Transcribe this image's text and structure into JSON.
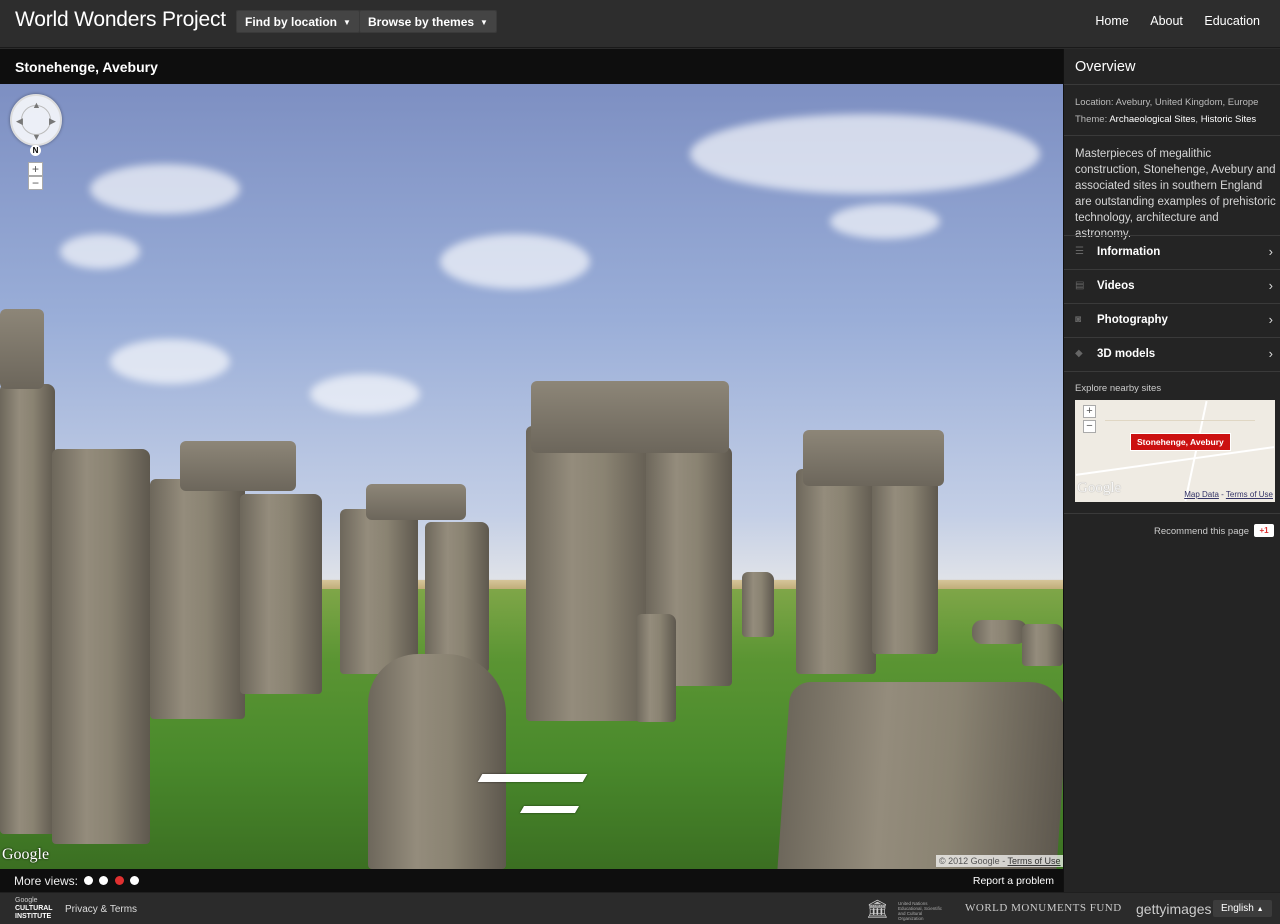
{
  "header": {
    "brand": "World Wonders Project",
    "find_by_location": "Find by location",
    "browse_by_themes": "Browse by themes",
    "links": [
      "Home",
      "About",
      "Education"
    ]
  },
  "viewer": {
    "title": "Stonehenge, Avebury",
    "compass_label": "N",
    "zoom_in": "+",
    "zoom_out": "−",
    "google_logo": "Google",
    "copyright": "© 2012 Google",
    "terms": "Terms of Use",
    "more_views_label": "More views:",
    "more_views_active_index": 2,
    "report_problem": "Report a problem"
  },
  "sidebar": {
    "heading": "Overview",
    "location_label": "Location: ",
    "location_value": "Avebury, United Kingdom, Europe",
    "theme_label": "Theme: ",
    "theme_value_1": "Archaeological Sites",
    "theme_separator": ", ",
    "theme_value_2": "Historic Sites",
    "description": "Masterpieces of megalithic construction, Stonehenge, Avebury and associated sites in southern England are outstanding examples of prehistoric technology, architecture and astronomy.",
    "sections": [
      {
        "label": "Information",
        "icon": "list-icon"
      },
      {
        "label": "Videos",
        "icon": "film-icon"
      },
      {
        "label": "Photography",
        "icon": "camera-icon"
      },
      {
        "label": "3D models",
        "icon": "cube-icon"
      }
    ],
    "explore_label": "Explore nearby sites",
    "map_pin": "Stonehenge, Avebury",
    "map_google": "Google",
    "map_data": "Map Data",
    "map_sep": " - ",
    "map_terms": "Terms of Use",
    "recommend": "Recommend this page",
    "gplus": "+1"
  },
  "footer": {
    "gci_line1": "Google",
    "gci_line2": "CULTURAL",
    "gci_line3": "INSTITUTE",
    "privacy": "Privacy & Terms",
    "unesco_text": "United Nations Educational, Scientific and Cultural Organization",
    "wmf": "WORLD MONUMENTS FUND",
    "getty": "gettyimages",
    "language": "English"
  },
  "colors": {
    "header_bg": "#2d2d2d",
    "panel_bg": "#242424",
    "titlebar_bg": "#0e0e0e",
    "pin_red": "#cc1111",
    "active_dot": "#e03030"
  }
}
